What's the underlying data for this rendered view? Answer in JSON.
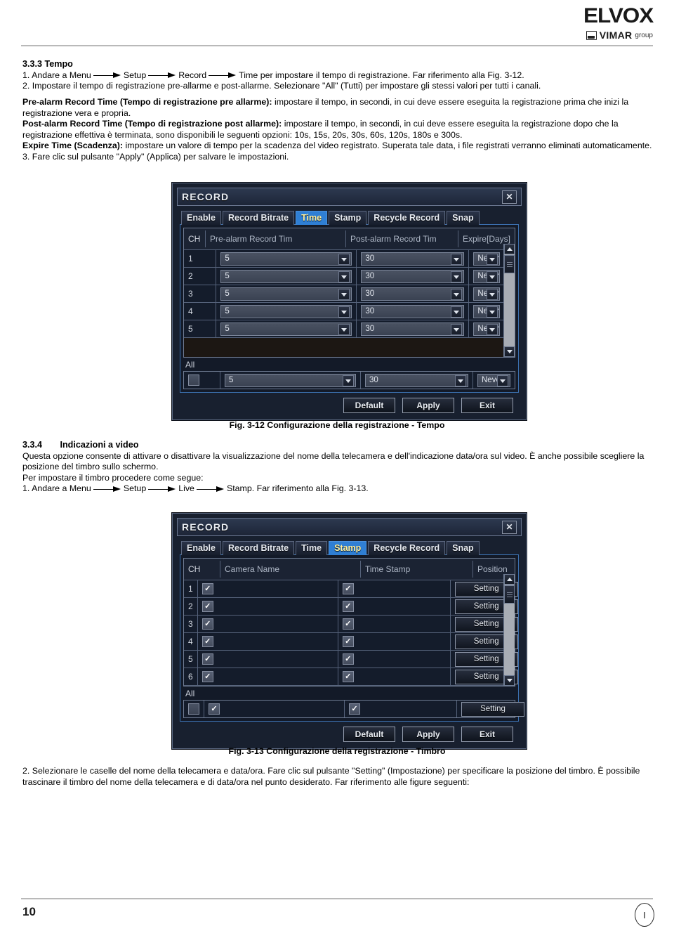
{
  "brand": {
    "name": "ELVOX",
    "group_name": "VIMAR",
    "group_suffix": "group"
  },
  "footer": {
    "page_number": "10",
    "language_code": "I"
  },
  "section_3_3_3": {
    "heading": "3.3.3 Tempo",
    "step1_a": "1. Andare a Menu",
    "step1_b": "Setup",
    "step1_c": "Record",
    "step1_d": "Time per impostare il tempo di registrazione. Far riferimento alla Fig. 3-12.",
    "step2": "2. Impostare il tempo di registrazione pre-allarme e post-allarme. Selezionare \"All\" (Tutti) per impostare gli stessi valori per tutti i canali.",
    "prealarm_label": "Pre-alarm Record Time (Tempo di registrazione pre allarme):",
    "prealarm_text": " impostare il tempo, in secondi, in cui deve essere eseguita la registrazione prima che inizi la registrazione vera e propria.",
    "postalarm_label": "Post-alarm Record Time (Tempo di registrazione post allarme):",
    "postalarm_text": " impostare il tempo, in secondi, in cui deve essere eseguita la registrazione dopo che la registrazione effettiva è terminata, sono disponibili le seguenti opzioni: 10s, 15s, 20s, 30s, 60s, 120s, 180s e 300s.",
    "expire_label": "Expire Time (Scadenza):",
    "expire_text": " impostare un valore di tempo per la scadenza del video registrato. Superata tale data, i file registrati verranno eliminati automaticamente.",
    "step3": "3. Fare clic sul pulsante \"Apply\" (Applica) per salvare le impostazioni."
  },
  "fig_3_12_caption": "Fig. 3-12 Configurazione della registrazione - Tempo",
  "section_3_3_4": {
    "number": "3.3.4",
    "heading": "Indicazioni a video",
    "para1": "Questa opzione consente di attivare o disattivare la visualizzazione del nome della telecamera e dell'indicazione data/ora sul video. È anche possibile scegliere la posizione del timbro sullo schermo.",
    "para2": "Per impostare il timbro procedere come segue:",
    "step1_a": "1. Andare a Menu",
    "step1_b": "Setup",
    "step1_c": "Live",
    "step1_d": "Stamp. Far riferimento alla Fig. 3-13."
  },
  "fig_3_13_caption": "Fig. 3-13 Configurazione della registrazione - Timbro",
  "closing_text": "2. Selezionare le caselle del nome della telecamera e data/ora. Fare clic sul pulsante \"Setting\" (Impostazione) per specificare la posizione del timbro. È possibile trascinare il timbro del nome della telecamera e di data/ora nel punto desiderato. Far riferimento alle figure seguenti:",
  "dialog_time": {
    "title": "RECORD",
    "close_label": "✕",
    "tabs": [
      {
        "label": "Enable",
        "selected": false
      },
      {
        "label": "Record Bitrate",
        "selected": false
      },
      {
        "label": "Time",
        "selected": true
      },
      {
        "label": "Stamp",
        "selected": false
      },
      {
        "label": "Recycle Record",
        "selected": false
      },
      {
        "label": "Snap",
        "selected": false
      }
    ],
    "columns": [
      "CH",
      "Pre-alarm Record Tim",
      "Post-alarm Record Tim",
      "Expire[Days]"
    ],
    "rows": [
      {
        "ch": "1",
        "pre": "5",
        "post": "30",
        "expire": "Never"
      },
      {
        "ch": "2",
        "pre": "5",
        "post": "30",
        "expire": "Never"
      },
      {
        "ch": "3",
        "pre": "5",
        "post": "30",
        "expire": "Never"
      },
      {
        "ch": "4",
        "pre": "5",
        "post": "30",
        "expire": "Never"
      },
      {
        "ch": "5",
        "pre": "5",
        "post": "30",
        "expire": "Never"
      }
    ],
    "all_label": "All",
    "all_row": {
      "checked": false,
      "pre": "5",
      "post": "30",
      "expire": "Never"
    },
    "buttons": [
      "Default",
      "Apply",
      "Exit"
    ]
  },
  "dialog_stamp": {
    "title": "RECORD",
    "close_label": "✕",
    "tabs": [
      {
        "label": "Enable",
        "selected": false
      },
      {
        "label": "Record Bitrate",
        "selected": false
      },
      {
        "label": "Time",
        "selected": false
      },
      {
        "label": "Stamp",
        "selected": true
      },
      {
        "label": "Recycle Record",
        "selected": false
      },
      {
        "label": "Snap",
        "selected": false
      }
    ],
    "columns": [
      "CH",
      "Camera Name",
      "Time Stamp",
      "Position"
    ],
    "setting_label": "Setting",
    "rows": [
      {
        "ch": "1",
        "camera_name": true,
        "time_stamp": true
      },
      {
        "ch": "2",
        "camera_name": true,
        "time_stamp": true
      },
      {
        "ch": "3",
        "camera_name": true,
        "time_stamp": true
      },
      {
        "ch": "4",
        "camera_name": true,
        "time_stamp": true
      },
      {
        "ch": "5",
        "camera_name": true,
        "time_stamp": true
      },
      {
        "ch": "6",
        "camera_name": true,
        "time_stamp": true
      }
    ],
    "all_label": "All",
    "all_row": {
      "checked": false,
      "camera_name": true,
      "time_stamp": true
    },
    "buttons": [
      "Default",
      "Apply",
      "Exit"
    ]
  }
}
